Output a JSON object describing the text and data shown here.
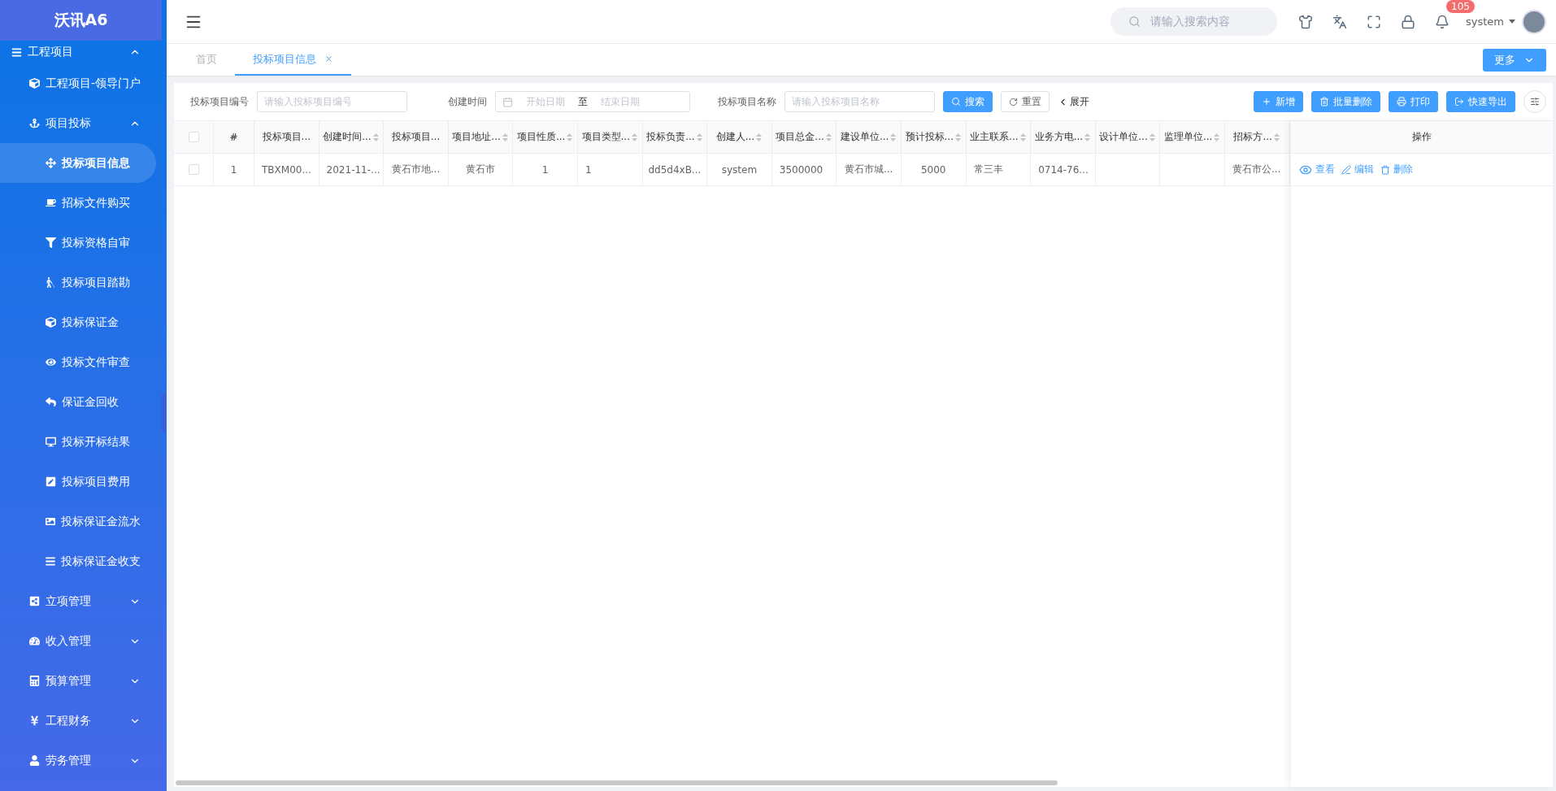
{
  "sidebar": {
    "logo": "沃讯A6",
    "items": [
      {
        "label": "工程项目",
        "expanded": true,
        "selected": false,
        "children": [
          {
            "label": "工程项目-领导门户",
            "selected": false
          },
          {
            "label": "项目投标",
            "expanded": true,
            "selected": false,
            "children": [
              {
                "label": "投标项目信息",
                "selected": true
              },
              {
                "label": "招标文件购买",
                "selected": false
              },
              {
                "label": "投标资格自审",
                "selected": false
              },
              {
                "label": "投标项目踏勘",
                "selected": false
              },
              {
                "label": "投标保证金",
                "selected": false
              },
              {
                "label": "投标文件审查",
                "selected": false
              },
              {
                "label": "保证金回收",
                "selected": false
              },
              {
                "label": "投标开标结果",
                "selected": false
              },
              {
                "label": "投标项目费用",
                "selected": false
              },
              {
                "label": "投标保证金流水",
                "selected": false
              },
              {
                "label": "投标保证金收支",
                "selected": false
              }
            ]
          }
        ]
      },
      {
        "label": "立项管理",
        "expanded": false,
        "selected": false
      },
      {
        "label": "收入管理",
        "expanded": false,
        "selected": false
      },
      {
        "label": "预算管理",
        "expanded": false,
        "selected": false
      },
      {
        "label": "工程财务",
        "expanded": false,
        "selected": false
      },
      {
        "label": "劳务管理",
        "expanded": false,
        "selected": false
      }
    ]
  },
  "header": {
    "search": {
      "placeholder": "请输入搜索内容"
    },
    "notifications": "105",
    "user": "system"
  },
  "tabs": [
    {
      "label": "首页",
      "selected": false,
      "closable": false
    },
    {
      "label": "投标项目信息",
      "selected": true,
      "closable": true
    }
  ],
  "more_button": "更多",
  "filters": {
    "project_no": {
      "label": "投标项目编号",
      "placeholder": "请输入投标项目编号"
    },
    "created": {
      "label": "创建时间",
      "start_placeholder": "开始日期",
      "separator": "至",
      "end_placeholder": "结束日期"
    },
    "project_name": {
      "label": "投标项目名称",
      "placeholder": "请输入投标项目名称"
    },
    "search": "搜索",
    "reset": "重置",
    "expand": "展开"
  },
  "toolbar": [
    {
      "label": "新增",
      "kind": "add"
    },
    {
      "label": "批量删除",
      "kind": "delete"
    },
    {
      "label": "打印",
      "kind": "print"
    },
    {
      "label": "快速导出",
      "kind": "export"
    }
  ],
  "table": {
    "columns": [
      {
        "label": "#",
        "sortable": false
      },
      {
        "label": "投标项目...",
        "sortable": false
      },
      {
        "label": "创建时间...",
        "sortable": true
      },
      {
        "label": "投标项目...",
        "sortable": false
      },
      {
        "label": "项目地址...",
        "sortable": true
      },
      {
        "label": "项目性质...",
        "sortable": true
      },
      {
        "label": "项目类型...",
        "sortable": true
      },
      {
        "label": "投标负责...",
        "sortable": true
      },
      {
        "label": "创建人...",
        "sortable": true
      },
      {
        "label": "项目总金...",
        "sortable": true
      },
      {
        "label": "建设单位...",
        "sortable": true
      },
      {
        "label": "预计投标...",
        "sortable": true
      },
      {
        "label": "业主联系...",
        "sortable": true
      },
      {
        "label": "业务方电...",
        "sortable": true
      },
      {
        "label": "设计单位...",
        "sortable": true
      },
      {
        "label": "监理单位...",
        "sortable": true
      },
      {
        "label": "招标方...",
        "sortable": true
      }
    ],
    "all_checked": false,
    "actions_header": "操作",
    "rows": [
      {
        "checked": false,
        "cells": [
          "1",
          "TBXM00...",
          "2021-11-...",
          "黄石市地...",
          "黄石市",
          "1",
          "1",
          "dd5d4xB...",
          "system",
          "3500000",
          "黄石市城...",
          "5000",
          "常三丰",
          "0714-76...",
          "",
          "",
          "黄石市公..."
        ],
        "actions": [
          {
            "label": "查看",
            "kind": "view"
          },
          {
            "label": "编辑",
            "kind": "edit"
          },
          {
            "label": "删除",
            "kind": "delete"
          }
        ]
      }
    ]
  }
}
